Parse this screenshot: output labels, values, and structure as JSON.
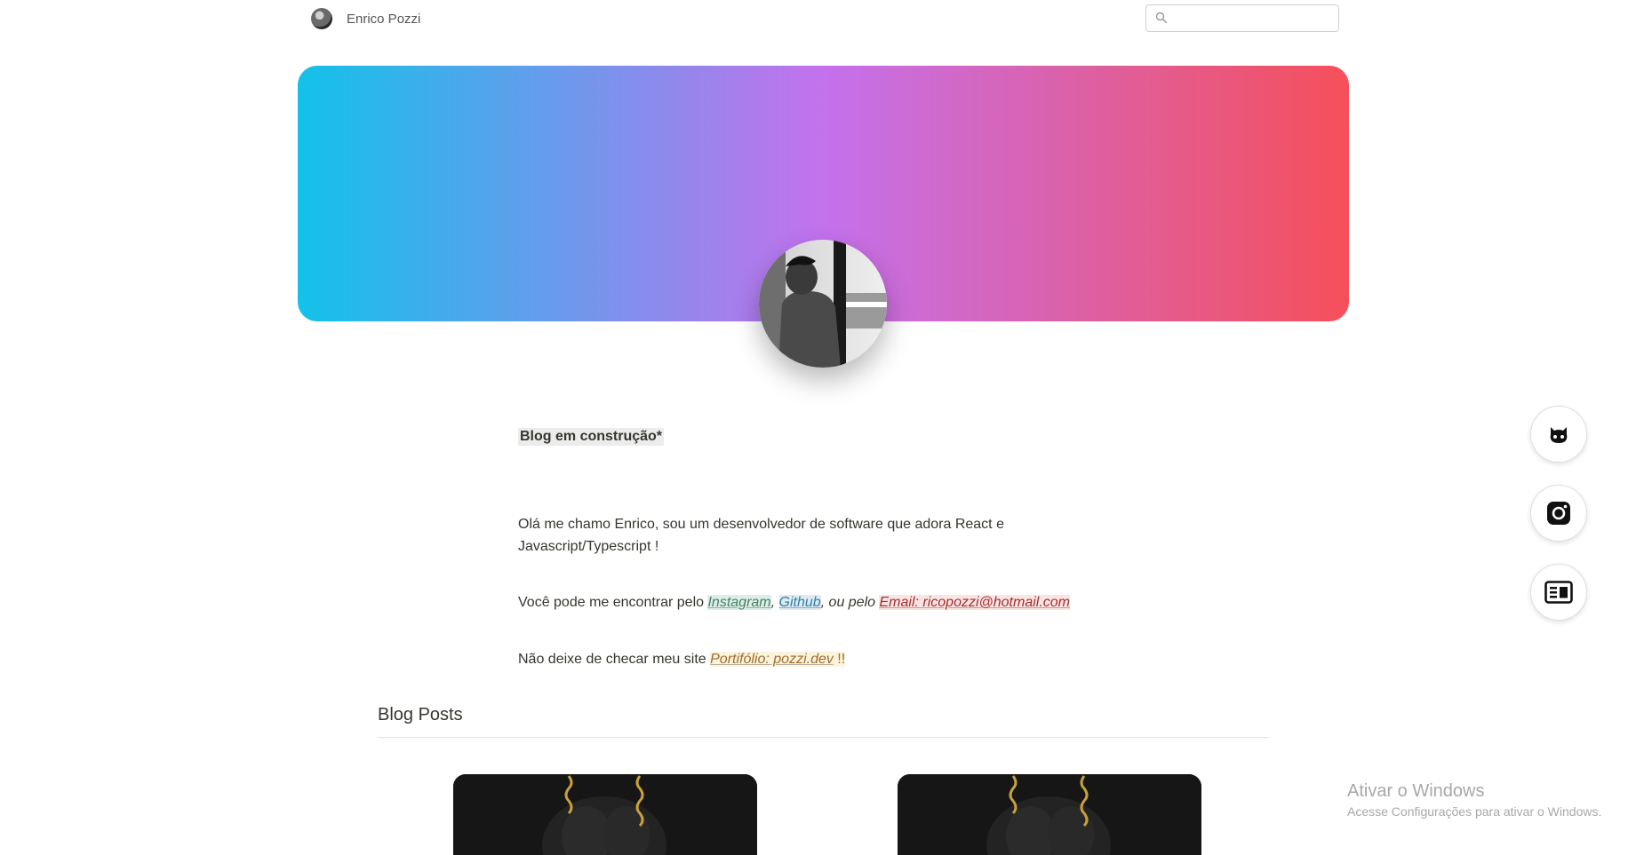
{
  "header": {
    "site_name": "Enrico Pozzi",
    "search_placeholder": ""
  },
  "notice": "Blog em construção*",
  "intro": "Olá me chamo Enrico, sou um desenvolvedor de software que adora React e Javascript/Typescript !",
  "contact": {
    "prefix": "Você pode me encontrar pelo ",
    "instagram": "Instagram",
    "sep1": ", ",
    "github": "Github",
    "sep2": ", ",
    "mid": "ou pelo ",
    "email": "Email: ricopozzi@hotmail.com"
  },
  "portfolio": {
    "prefix": "Não deixe de checar meu site ",
    "link": "Portifólio: pozzi.dev",
    "suffix": " !!"
  },
  "section": {
    "title": "Blog Posts"
  },
  "social": [
    "github-icon",
    "instagram-icon",
    "newspaper-icon"
  ],
  "colors": {
    "gradient_start": "#12c2e9",
    "gradient_mid": "#c471ed",
    "gradient_end": "#f64f59"
  },
  "watermark": {
    "title": "Ativar o Windows",
    "subtitle": "Acesse Configurações para ativar o Windows."
  }
}
